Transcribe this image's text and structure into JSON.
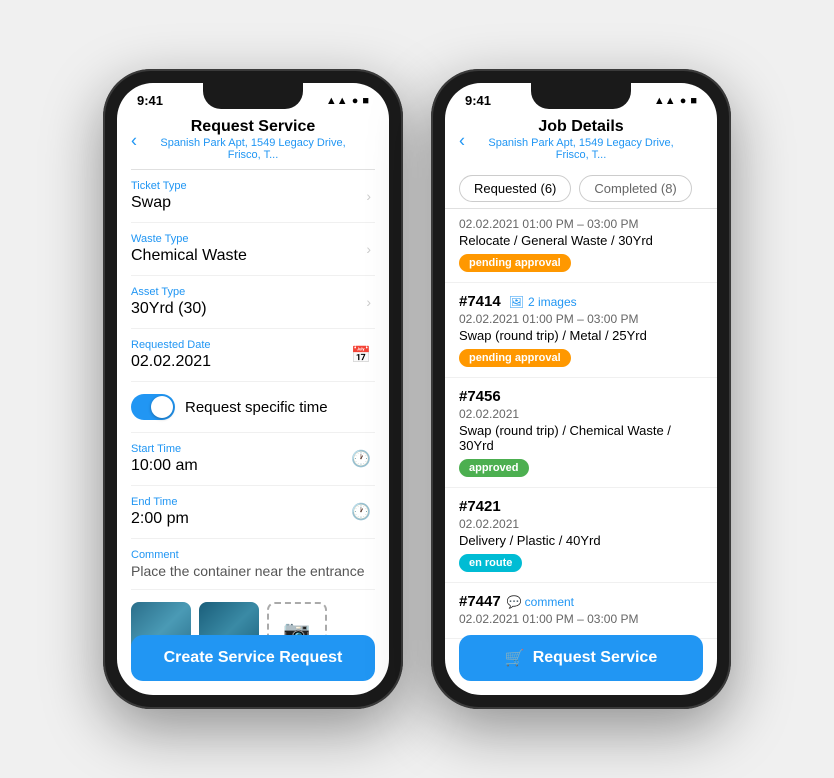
{
  "phone1": {
    "status_time": "9:41",
    "status_icons": "▲▲ ● ■",
    "nav_title": "Request Service",
    "nav_subtitle": "Spanish Park Apt, 1549 Legacy Drive, Frisco, T...",
    "back_label": "‹",
    "fields": [
      {
        "id": "ticket-type",
        "label": "Ticket Type",
        "value": "Swap",
        "has_chevron": true
      },
      {
        "id": "waste-type",
        "label": "Waste Type",
        "value": "Chemical Waste",
        "has_chevron": true
      },
      {
        "id": "asset-type",
        "label": "Asset Type",
        "value": "30Yrd (30)",
        "has_chevron": true
      },
      {
        "id": "requested-date",
        "label": "Requested Date",
        "value": "02.02.2021",
        "has_calendar": true
      }
    ],
    "toggle_label": "Request specific time",
    "time_fields": [
      {
        "id": "start-time",
        "label": "Start Time",
        "value": "10:00 am"
      },
      {
        "id": "end-time",
        "label": "End Time",
        "value": "2:00 pm"
      }
    ],
    "comment_label": "Comment",
    "comment_value": "Place the container near the entrance",
    "create_btn": "Create Service Request"
  },
  "phone2": {
    "status_time": "9:41",
    "nav_title": "Job Details",
    "nav_subtitle": "Spanish Park Apt, 1549 Legacy Drive, Frisco, T...",
    "back_label": "‹",
    "tabs": [
      {
        "label": "Requested (6)",
        "active": true
      },
      {
        "label": "Completed (8)",
        "active": false
      }
    ],
    "first_item": {
      "date": "02.02.2021  01:00 PM – 03:00 PM",
      "desc": "Relocate / General Waste / 30Yrd",
      "badge": "pending approval",
      "badge_type": "pending"
    },
    "jobs": [
      {
        "num": "#7414",
        "has_images": true,
        "images_count": "2 images",
        "date": "02.02.2021  01:00 PM – 03:00 PM",
        "desc": "Swap (round trip) / Metal / 25Yrd",
        "badge": "pending approval",
        "badge_type": "pending"
      },
      {
        "num": "#7456",
        "date": "02.02.2021",
        "desc": "Swap (round trip) / Chemical Waste / 30Yrd",
        "badge": "approved",
        "badge_type": "approved"
      },
      {
        "num": "#7421",
        "date": "02.02.2021",
        "desc": "Delivery / Plastic / 40Yrd",
        "badge": "en route",
        "badge_type": "enroute"
      },
      {
        "num": "#7447",
        "has_comment": true,
        "comment_label": "comment",
        "date": "02.02.2021  01:00 PM – 03:00 PM",
        "desc": "",
        "badge": "",
        "badge_type": ""
      }
    ],
    "request_service_btn": "Request Service"
  }
}
